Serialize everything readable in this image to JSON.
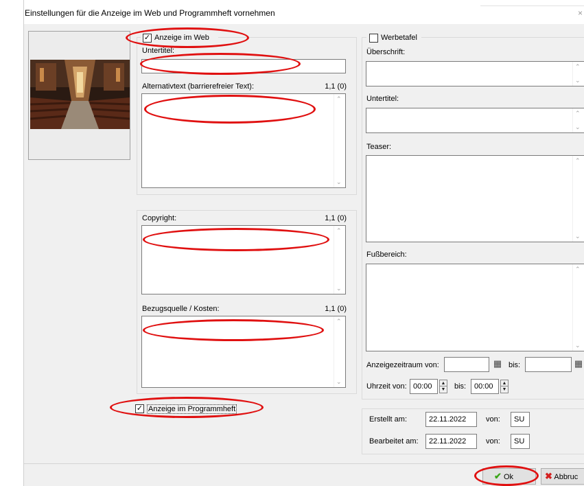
{
  "window": {
    "title": "Einstellungen für die Anzeige im Web und Programmheft vornehmen"
  },
  "web": {
    "checkbox_label": "Anzeige im Web",
    "checked": true,
    "subtitle_label": "Untertitel:",
    "alt_label": "Alternativtext (barrierefreier Text):",
    "alt_counter": "1,1 (0)"
  },
  "copyright_group": {
    "copyright_label": "Copyright:",
    "copyright_counter": "1,1 (0)",
    "source_label": "Bezugsquelle / Kosten:",
    "source_counter": "1,1 (0)"
  },
  "program": {
    "checkbox_label": "Anzeige im Programmheft",
    "checked": true
  },
  "billboard": {
    "checkbox_label": "Werbetafel",
    "checked": false,
    "heading_label": "Überschrift:",
    "subtitle_label": "Untertitel:",
    "teaser_label": "Teaser:",
    "footer_label": "Fußbereich:",
    "period_label": "Anzeigezeitraum von:",
    "until_label": "bis:",
    "time_label": "Uhrzeit von:",
    "time_from": "00:00",
    "time_until_label": "bis:",
    "time_to": "00:00"
  },
  "meta": {
    "created_label": "Erstellt am:",
    "created_date": "22.11.2022",
    "created_by_label": "von:",
    "created_by": "SU",
    "edited_label": "Bearbeitet am:",
    "edited_date": "22.11.2022",
    "edited_by_label": "von:",
    "edited_by": "SU"
  },
  "buttons": {
    "ok": "Ok",
    "cancel": "Abbruc"
  },
  "colors": {
    "annotation": "#e01010",
    "ok_check": "#3aa517",
    "cancel_x": "#d42020"
  },
  "icons": {
    "ok": "check-icon",
    "cancel": "x-icon",
    "calendar": "calendar-icon"
  }
}
